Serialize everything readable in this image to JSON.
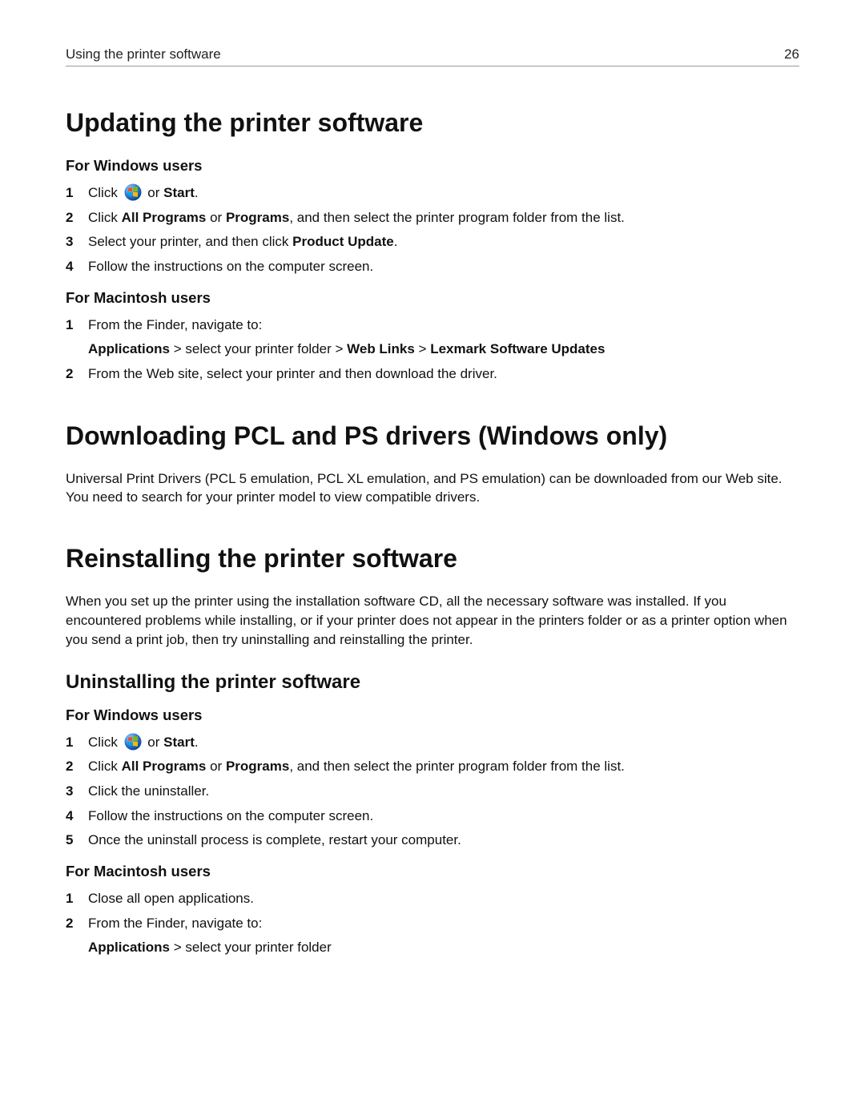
{
  "header": {
    "title": "Using the printer software",
    "page_number": "26"
  },
  "section_update": {
    "heading": "Updating the printer software",
    "windows": {
      "heading": "For Windows users",
      "step1_pre": "Click ",
      "step1_post": " or ",
      "step1_bold": "Start",
      "step1_end": ".",
      "step2_pre": "Click ",
      "step2_b1": "All Programs",
      "step2_mid1": " or ",
      "step2_b2": "Programs",
      "step2_post": ", and then select the printer program folder from the list.",
      "step3_pre": "Select your printer, and then click ",
      "step3_b": "Product Update",
      "step3_end": ".",
      "step4": "Follow the instructions on the computer screen."
    },
    "mac": {
      "heading": "For Macintosh users",
      "step1": "From the Finder, navigate to:",
      "step1_sub_b1": "Applications",
      "step1_sub_t1": " > select your printer folder > ",
      "step1_sub_b2": "Web Links",
      "step1_sub_t2": " > ",
      "step1_sub_b3": "Lexmark Software Updates",
      "step2": "From the Web site, select your printer and then download the driver."
    }
  },
  "section_download": {
    "heading": "Downloading PCL and PS drivers (Windows only)",
    "body": "Universal Print Drivers (PCL 5 emulation, PCL XL emulation, and PS emulation) can be downloaded from our Web site. You need to search for your printer model to view compatible drivers."
  },
  "section_reinstall": {
    "heading": "Reinstalling the printer software",
    "body": "When you set up the printer using the installation software CD, all the necessary software was installed. If you encountered problems while installing, or if your printer does not appear in the printers folder or as a printer option when you send a print job, then try uninstalling and reinstalling the printer.",
    "uninstall_heading": "Uninstalling the printer software",
    "windows": {
      "heading": "For Windows users",
      "step1_pre": "Click ",
      "step1_post": " or ",
      "step1_bold": "Start",
      "step1_end": ".",
      "step2_pre": "Click ",
      "step2_b1": "All Programs",
      "step2_mid1": " or ",
      "step2_b2": "Programs",
      "step2_post": ", and then select the printer program folder from the list.",
      "step3": "Click the uninstaller.",
      "step4": "Follow the instructions on the computer screen.",
      "step5": "Once the uninstall process is complete, restart your computer."
    },
    "mac": {
      "heading": "For Macintosh users",
      "step1": "Close all open applications.",
      "step2": "From the Finder, navigate to:",
      "step2_sub_b": "Applications",
      "step2_sub_t": " > select your printer folder"
    }
  }
}
